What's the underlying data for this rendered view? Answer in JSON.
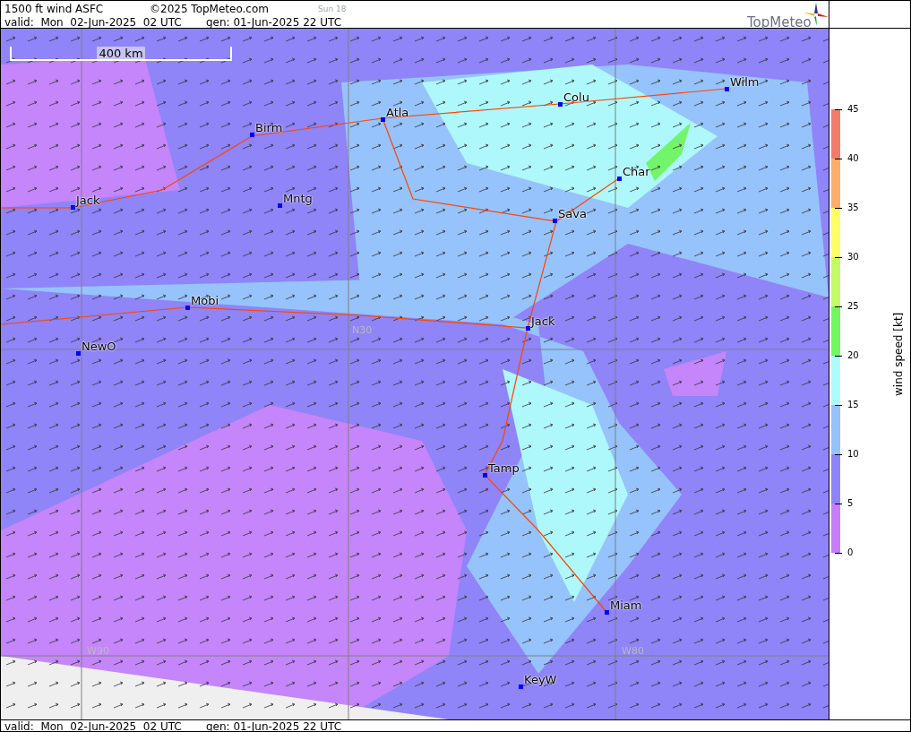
{
  "header": {
    "title": "1500 ft wind ASFC",
    "copyright": "©2025 TopMeteo.com",
    "run": "Sun 18",
    "valid": "valid:  Mon  02-Jun-2025  02 UTC",
    "generated": "gen: 01-Jun-2025 22 UTC",
    "logo": "TopMeteo"
  },
  "map": {
    "scale": "400 km",
    "cities": [
      {
        "name": "Colu"
      },
      {
        "name": "Wilm"
      },
      {
        "name": "Atla"
      },
      {
        "name": "Birm"
      },
      {
        "name": "Char"
      },
      {
        "name": "Jack"
      },
      {
        "name": "Mntg"
      },
      {
        "name": "Sava"
      },
      {
        "name": "Mobi"
      },
      {
        "name": "Jack"
      },
      {
        "name": "NewO"
      },
      {
        "name": "Tamp"
      },
      {
        "name": "Miam"
      },
      {
        "name": "KeyW"
      }
    ],
    "grid_labels": [
      "N30",
      "W90",
      "W80"
    ]
  },
  "legend": {
    "title": "wind speed [kt]",
    "ticks": [
      "45",
      "40",
      "35",
      "30",
      "25",
      "20",
      "15",
      "10",
      "5",
      "0"
    ],
    "bands": [
      {
        "color": "#f07c6b"
      },
      {
        "color": "#fdae6b"
      },
      {
        "color": "#fefe66"
      },
      {
        "color": "#c3fb66"
      },
      {
        "color": "#73f75f"
      },
      {
        "color": "#adfcfd"
      },
      {
        "color": "#96c1fb"
      },
      {
        "color": "#8f83f8"
      },
      {
        "color": "#c57dfb"
      }
    ]
  },
  "footer": {
    "valid": "valid:  Mon  02-Jun-2025  02 UTC",
    "generated": "gen: 01-Jun-2025 22 UTC"
  }
}
